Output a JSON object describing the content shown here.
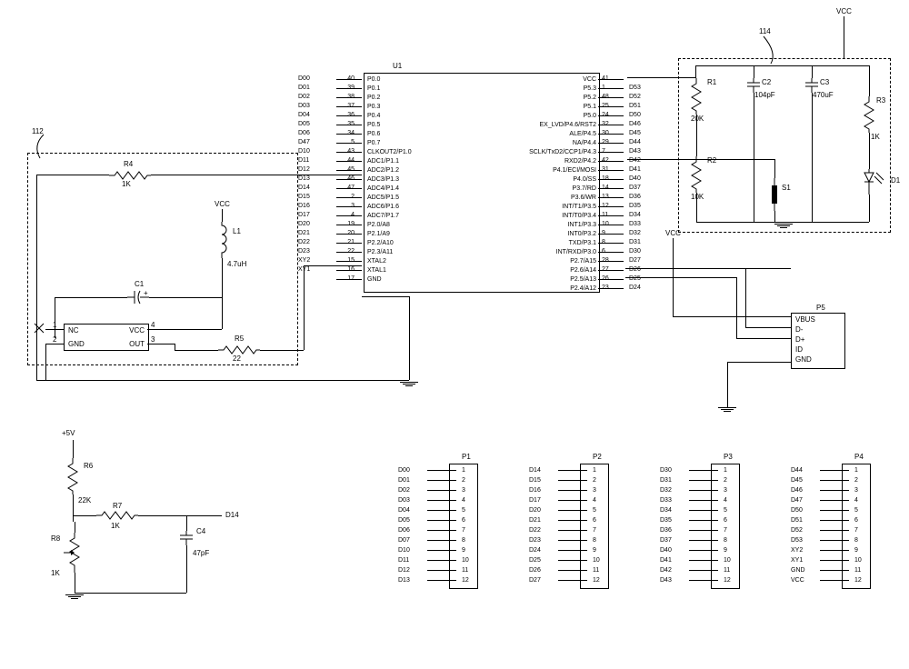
{
  "blocks": {
    "b112": "112",
    "b114": "114"
  },
  "vcc": "VCC",
  "plus5v": "+5V",
  "r1": {
    "name": "R1",
    "val": "20K"
  },
  "r2": {
    "name": "R2",
    "val": "10K"
  },
  "r3": {
    "name": "R3",
    "val": "1K"
  },
  "r4": {
    "name": "R4",
    "val": "1K"
  },
  "r5_": {
    "name": "R5",
    "val": "22"
  },
  "r6": {
    "name": "R6",
    "val": "22K"
  },
  "r7": {
    "name": "R7",
    "val": "1K"
  },
  "r8": {
    "name": "R8",
    "val": "1K"
  },
  "c1": "C1",
  "c2": {
    "name": "C2",
    "val": "104pF"
  },
  "c3": {
    "name": "C3",
    "val": "470uF"
  },
  "c4": {
    "name": "C4",
    "val": "47pF"
  },
  "l1": {
    "name": "L1",
    "val": "4.7uH"
  },
  "s1": "S1",
  "d1": "D1",
  "d14_net": "D14",
  "u1_ref": "U1",
  "u2": {
    "p1": "1",
    "p2": "2",
    "p3": "3",
    "p4": "4",
    "nc": "NC",
    "vcc": "VCC",
    "gnd": "GND",
    "out": "OUT"
  },
  "p5": {
    "ref": "P5",
    "pins": [
      "VBUS",
      "D-",
      "D+",
      "ID",
      "GND"
    ]
  },
  "left_side": [
    {
      "net": "D00",
      "num": "40",
      "lbl": "P0.0"
    },
    {
      "net": "D01",
      "num": "39",
      "lbl": "P0.1"
    },
    {
      "net": "D02",
      "num": "38",
      "lbl": "P0.2"
    },
    {
      "net": "D03",
      "num": "37",
      "lbl": "P0.3"
    },
    {
      "net": "D04",
      "num": "36",
      "lbl": "P0.4"
    },
    {
      "net": "D05",
      "num": "35",
      "lbl": "P0.5"
    },
    {
      "net": "D06",
      "num": "34",
      "lbl": "P0.6"
    },
    {
      "net": "D47",
      "num": "5",
      "lbl": "P0.7"
    },
    {
      "net": "D10",
      "num": "43",
      "lbl": "CLKOUT2/P1.0"
    },
    {
      "net": "D11",
      "num": "44",
      "lbl": "ADC1/P1.1"
    },
    {
      "net": "D12",
      "num": "45",
      "lbl": "ADC2/P1.2"
    },
    {
      "net": "D13",
      "num": "46",
      "lbl": "ADC3/P1.3"
    },
    {
      "net": "D14",
      "num": "47",
      "lbl": "ADC4/P1.4"
    },
    {
      "net": "D15",
      "num": "2",
      "lbl": "ADC5/P1.5"
    },
    {
      "net": "D16",
      "num": "3",
      "lbl": "ADC6/P1.6"
    },
    {
      "net": "D17",
      "num": "4",
      "lbl": "ADC7/P1.7"
    },
    {
      "net": "D20",
      "num": "19",
      "lbl": "P2.0/A8"
    },
    {
      "net": "D21",
      "num": "20",
      "lbl": "P2.1/A9"
    },
    {
      "net": "D22",
      "num": "21",
      "lbl": "P2.2/A10"
    },
    {
      "net": "D23",
      "num": "22",
      "lbl": "P2.3/A11"
    },
    {
      "net": "XY2",
      "num": "15",
      "lbl": "XTAL2"
    },
    {
      "net": "XY1",
      "num": "16",
      "lbl": "XTAL1"
    },
    {
      "net": "",
      "num": "17",
      "lbl": "GND"
    }
  ],
  "right_side": [
    {
      "lbl": "VCC",
      "num": "41",
      "net": ""
    },
    {
      "lbl": "P5.3",
      "num": "1",
      "net": "D53"
    },
    {
      "lbl": "P5.2",
      "num": "48",
      "net": "D52"
    },
    {
      "lbl": "P5.1",
      "num": "25",
      "net": "D51"
    },
    {
      "lbl": "P5.0",
      "num": "24",
      "net": "D50"
    },
    {
      "lbl": "EX_LVD/P4.6/RST2",
      "num": "32",
      "net": "D46"
    },
    {
      "lbl": "ALE/P4.5",
      "num": "30",
      "net": "D45"
    },
    {
      "lbl": "NA/P4.4",
      "num": "29",
      "net": "D44"
    },
    {
      "lbl": "SCLK/TxD2/CCP1/P4.3",
      "num": "7",
      "net": "D43"
    },
    {
      "lbl": "RXD2/P4.2",
      "num": "42",
      "net": "D42"
    },
    {
      "lbl": "P4.1/ECI/MOSI",
      "num": "31",
      "net": "D41"
    },
    {
      "lbl": "P4.0/SS",
      "num": "18",
      "net": "D40"
    },
    {
      "lbl": "P3.7/RD",
      "num": "14",
      "net": "D37"
    },
    {
      "lbl": "P3.6/WR",
      "num": "13",
      "net": "D36"
    },
    {
      "lbl": "INT/T1/P3.5",
      "num": "12",
      "net": "D35"
    },
    {
      "lbl": "INT/T0/P3.4",
      "num": "11",
      "net": "D34"
    },
    {
      "lbl": "INT1/P3.3",
      "num": "10",
      "net": "D33"
    },
    {
      "lbl": "INT0/P3.2",
      "num": "9",
      "net": "D32"
    },
    {
      "lbl": "TXD/P3.1",
      "num": "8",
      "net": "D31"
    },
    {
      "lbl": "INT/RXD/P3.0",
      "num": "6",
      "net": "D30"
    },
    {
      "lbl": "P2.7/A15",
      "num": "28",
      "net": "D27"
    },
    {
      "lbl": "P2.6/A14",
      "num": "27",
      "net": "D26"
    },
    {
      "lbl": "P2.5/A13",
      "num": "26",
      "net": "D25"
    },
    {
      "lbl": "P2.4/A12",
      "num": "23",
      "net": "D24"
    }
  ],
  "p1": {
    "ref": "P1",
    "nets": [
      "D00",
      "D01",
      "D02",
      "D03",
      "D04",
      "D05",
      "D06",
      "D07",
      "D10",
      "D11",
      "D12",
      "D13"
    ]
  },
  "p2": {
    "ref": "P2",
    "nets": [
      "D14",
      "D15",
      "D16",
      "D17",
      "D20",
      "D21",
      "D22",
      "D23",
      "D24",
      "D25",
      "D26",
      "D27"
    ]
  },
  "p3": {
    "ref": "P3",
    "nets": [
      "D30",
      "D31",
      "D32",
      "D33",
      "D34",
      "D35",
      "D36",
      "D37",
      "D40",
      "D41",
      "D42",
      "D43"
    ]
  },
  "p4": {
    "ref": "P4",
    "nets": [
      "D44",
      "D45",
      "D46",
      "D47",
      "D50",
      "D51",
      "D52",
      "D53",
      "XY2",
      "XY1",
      "GND",
      "VCC"
    ]
  },
  "pin_nums": [
    "1",
    "2",
    "3",
    "4",
    "5",
    "6",
    "7",
    "8",
    "9",
    "10",
    "11",
    "12"
  ]
}
